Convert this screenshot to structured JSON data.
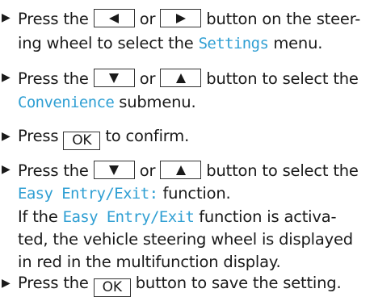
{
  "colors": {
    "text": "#1a1a1a",
    "display_text": "#2f9fd3",
    "key_border": "#333333"
  },
  "icons": {
    "bullet": "triangle-right-icon",
    "left": "left-triangle-icon",
    "right": "right-triangle-icon",
    "down": "down-triangle-icon",
    "up": "up-triangle-icon"
  },
  "step1": {
    "press_the": "Press the",
    "or": "or",
    "button_on_the_steer": "button on the steer-",
    "line2": "ing wheel to select the",
    "settings": "Settings",
    "menu": "menu."
  },
  "step2": {
    "press_the": "Press the",
    "or": "or",
    "button_to_select_the": "button to select the",
    "convenience": "Convenience",
    "submenu": "submenu."
  },
  "step3": {
    "press": "Press",
    "ok": "OK",
    "to_confirm": "to confirm."
  },
  "step4": {
    "press_the": "Press the",
    "or": "or",
    "button_to_select_the": "button to select the",
    "easy_entry_exit": "Easy Entry/Exit:",
    "function": "function.",
    "if_the": "If the",
    "easy_entry_exit_2": "Easy Entry/Exit",
    "function_is_activa": "function is activa-",
    "line4": "ted, the vehicle steering wheel is displayed",
    "line5": "in red in the multifunction display."
  },
  "step5": {
    "press_the": "Press the",
    "ok": "OK",
    "button_to_save": "button to save the setting."
  }
}
